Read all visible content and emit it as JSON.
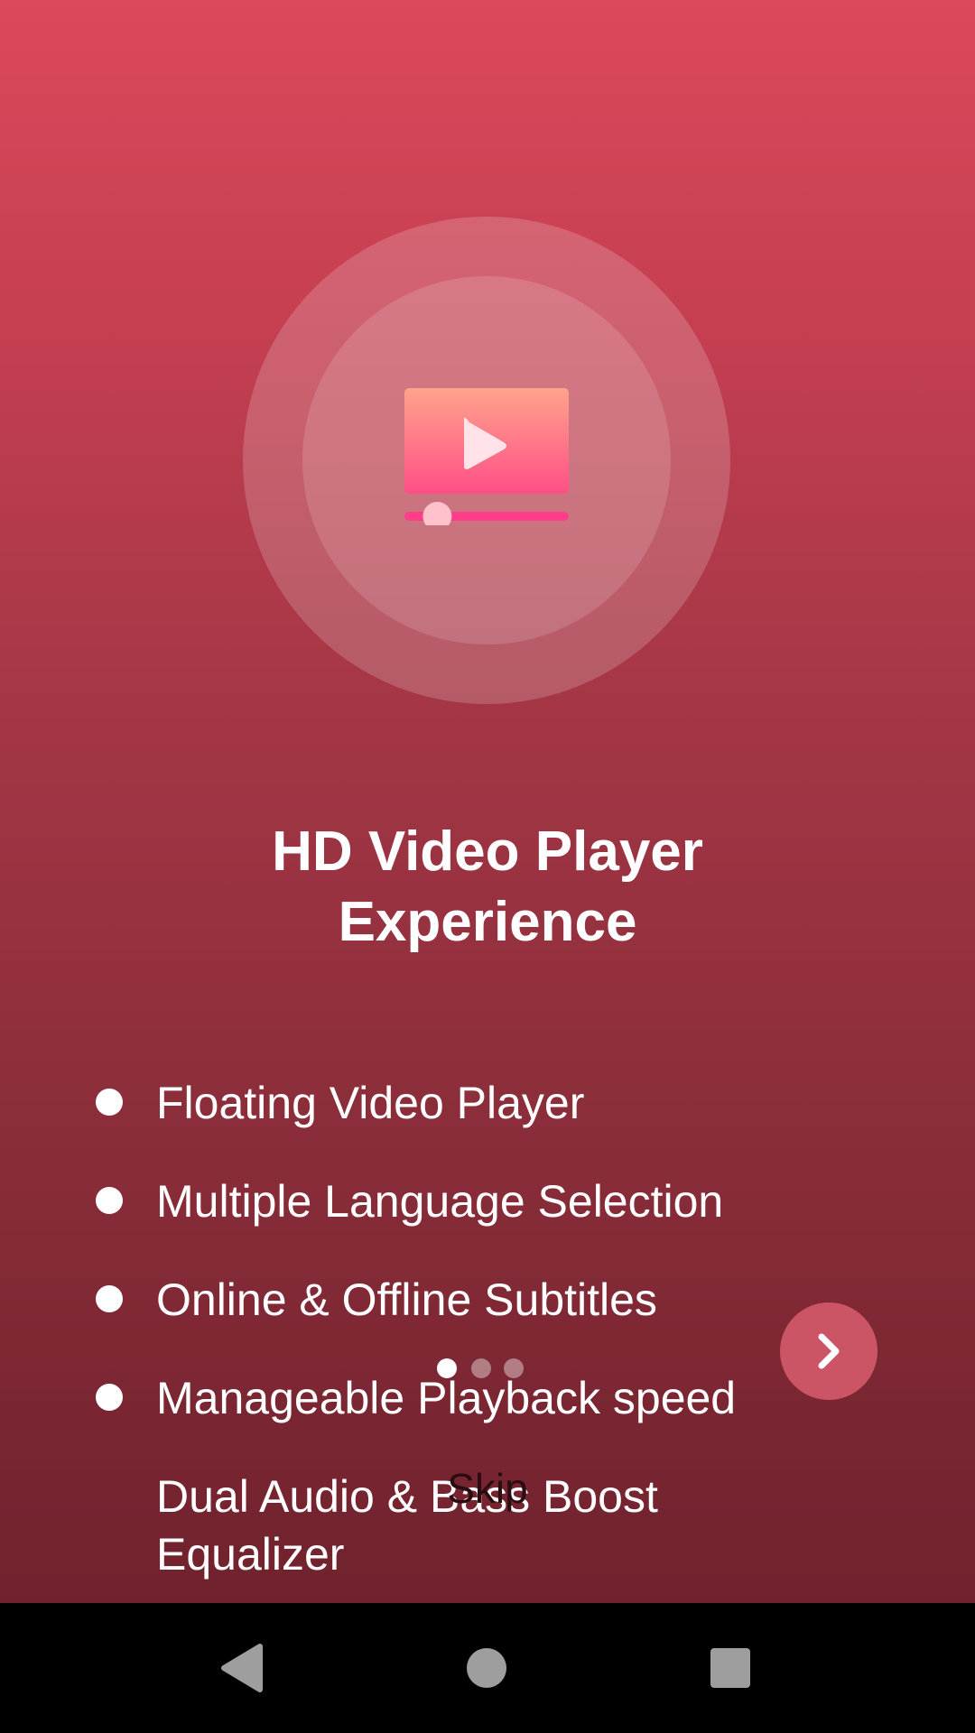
{
  "onboarding": {
    "title_lines": [
      "HD Video Player",
      "Experience"
    ],
    "features": [
      "Floating Video Player",
      "Multiple Language Selection",
      "Online & Offline Subtitles",
      "Manageable Playback speed",
      "Dual Audio & Bass Boost Equalizer"
    ],
    "feature_last_lines": [
      "Dual Audio & Bass Boost",
      "Equalizer"
    ],
    "page_indicator": {
      "count": 3,
      "active_index": 0
    },
    "next_icon": "chevron-right-icon",
    "skip_label": "Skip"
  },
  "illustration": {
    "icon": "video-player-icon",
    "progress_fraction": 0.2
  },
  "colors": {
    "gradient_top": "#dc485c",
    "gradient_bottom": "#6f222d",
    "accent": "#ff4f86",
    "next_button": "#cc5565"
  },
  "navbar": {
    "back_icon": "back-triangle-icon",
    "home_icon": "home-circle-icon",
    "recents_icon": "recents-square-icon"
  }
}
